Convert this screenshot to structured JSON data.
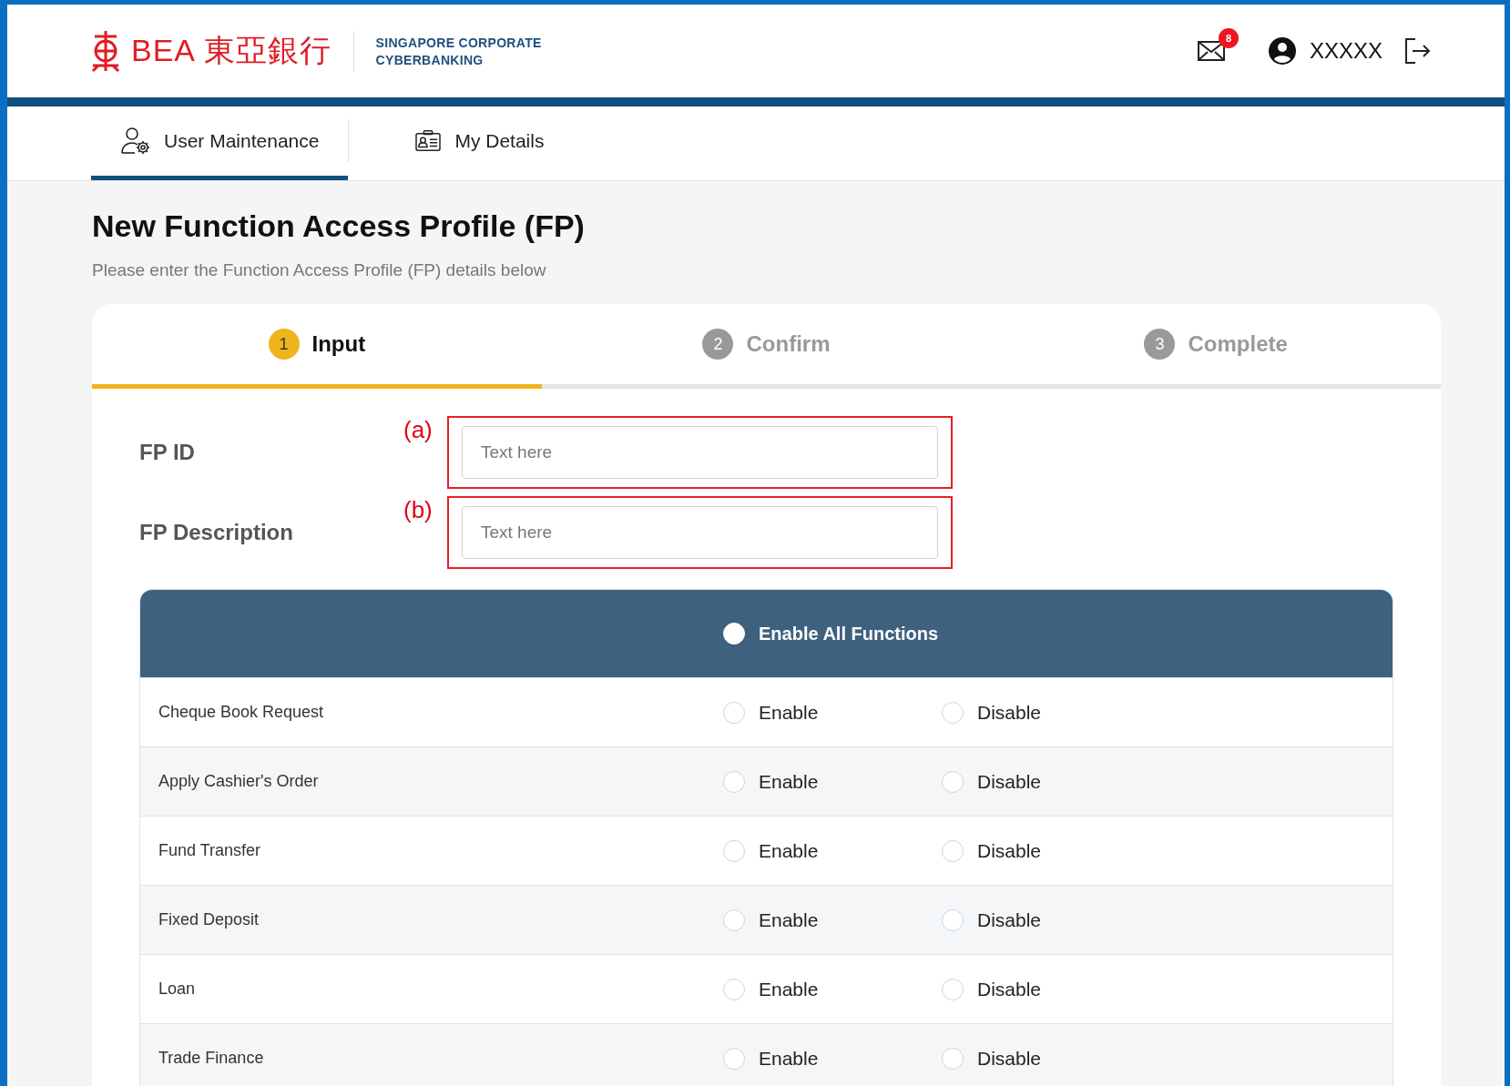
{
  "header": {
    "logo_text": "BEA 東亞銀行",
    "product": [
      "SINGAPORE CORPORATE",
      "CYBERBANKING"
    ],
    "mail_badge": "8",
    "username": "XXXXX"
  },
  "tabs": [
    {
      "label": "User Maintenance",
      "kind": "user",
      "selected": true
    },
    {
      "label": "My Details",
      "kind": "card",
      "selected": false
    }
  ],
  "page": {
    "title": "New Function Access Profile (FP)",
    "subtitle": "Please enter the Function Access Profile (FP) details below"
  },
  "steps": [
    {
      "number": "1",
      "label": "Input",
      "selected": true
    },
    {
      "number": "2",
      "label": "Confirm",
      "selected": false
    },
    {
      "number": "3",
      "label": "Complete",
      "selected": false
    }
  ],
  "fields": [
    {
      "label": "FP ID",
      "annotation": "(a)",
      "placeholder": "Text here"
    },
    {
      "label": "FP Description",
      "annotation": "(b)",
      "placeholder": "Text here"
    }
  ],
  "functions": {
    "enable_all": {
      "label": "Enable All Functions",
      "selected": false
    },
    "rows": [
      {
        "name": "Cheque Book Request",
        "options": [
          {
            "label": "Enable",
            "selected": false
          },
          {
            "label": "Disable",
            "selected": false
          }
        ]
      },
      {
        "name": "Apply Cashier's Order",
        "options": [
          {
            "label": "Enable",
            "selected": false
          },
          {
            "label": "Disable",
            "selected": false
          }
        ]
      },
      {
        "name": "Fund Transfer",
        "options": [
          {
            "label": "Enable",
            "selected": false
          },
          {
            "label": "Disable",
            "selected": false
          }
        ]
      },
      {
        "name": "Fixed Deposit",
        "options": [
          {
            "label": "Enable",
            "selected": false
          },
          {
            "label": "Disable",
            "selected": false
          }
        ]
      },
      {
        "name": "Loan",
        "options": [
          {
            "label": "Enable",
            "selected": false
          },
          {
            "label": "Disable",
            "selected": false
          }
        ]
      },
      {
        "name": "Trade Finance",
        "options": [
          {
            "label": "Enable",
            "selected": false
          },
          {
            "label": "Disable",
            "selected": false
          }
        ]
      }
    ]
  }
}
